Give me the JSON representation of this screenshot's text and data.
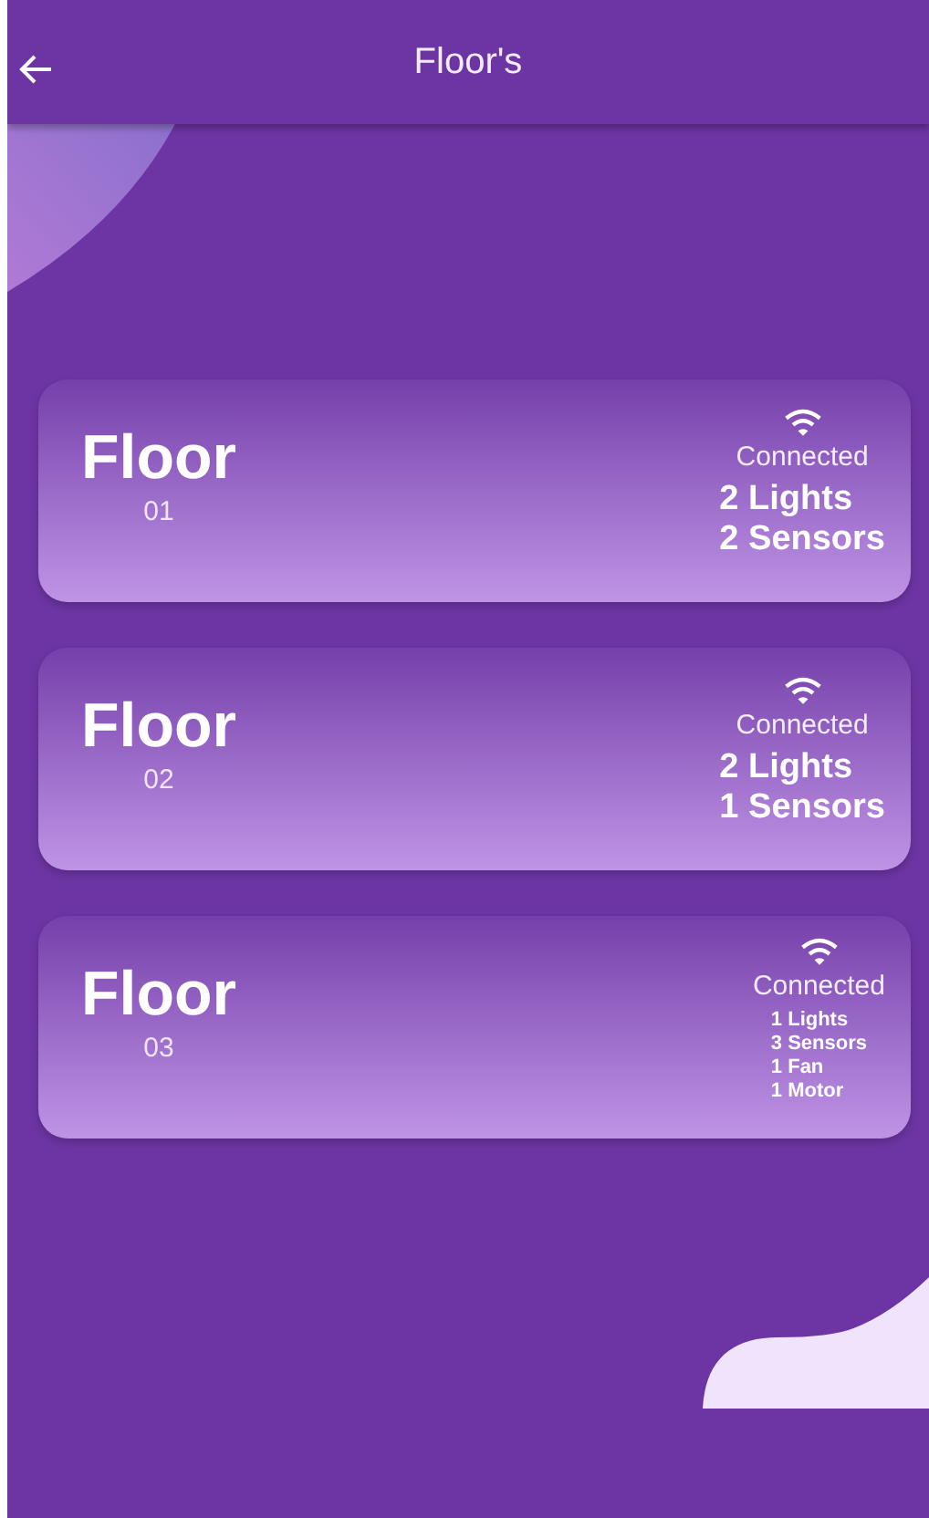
{
  "app_bar": {
    "title": "Floor's"
  },
  "floors": [
    {
      "label": "Floor",
      "number": "01",
      "status": "Connected",
      "devices": [
        "2 Lights",
        "2 Sensors"
      ]
    },
    {
      "label": "Floor",
      "number": "02",
      "status": "Connected",
      "devices": [
        "2 Lights",
        "1 Sensors"
      ]
    },
    {
      "label": "Floor",
      "number": "03",
      "status": "Connected",
      "devices": [
        "1 Lights",
        "3 Sensors",
        "1 Fan",
        "1 Motor"
      ]
    }
  ]
}
